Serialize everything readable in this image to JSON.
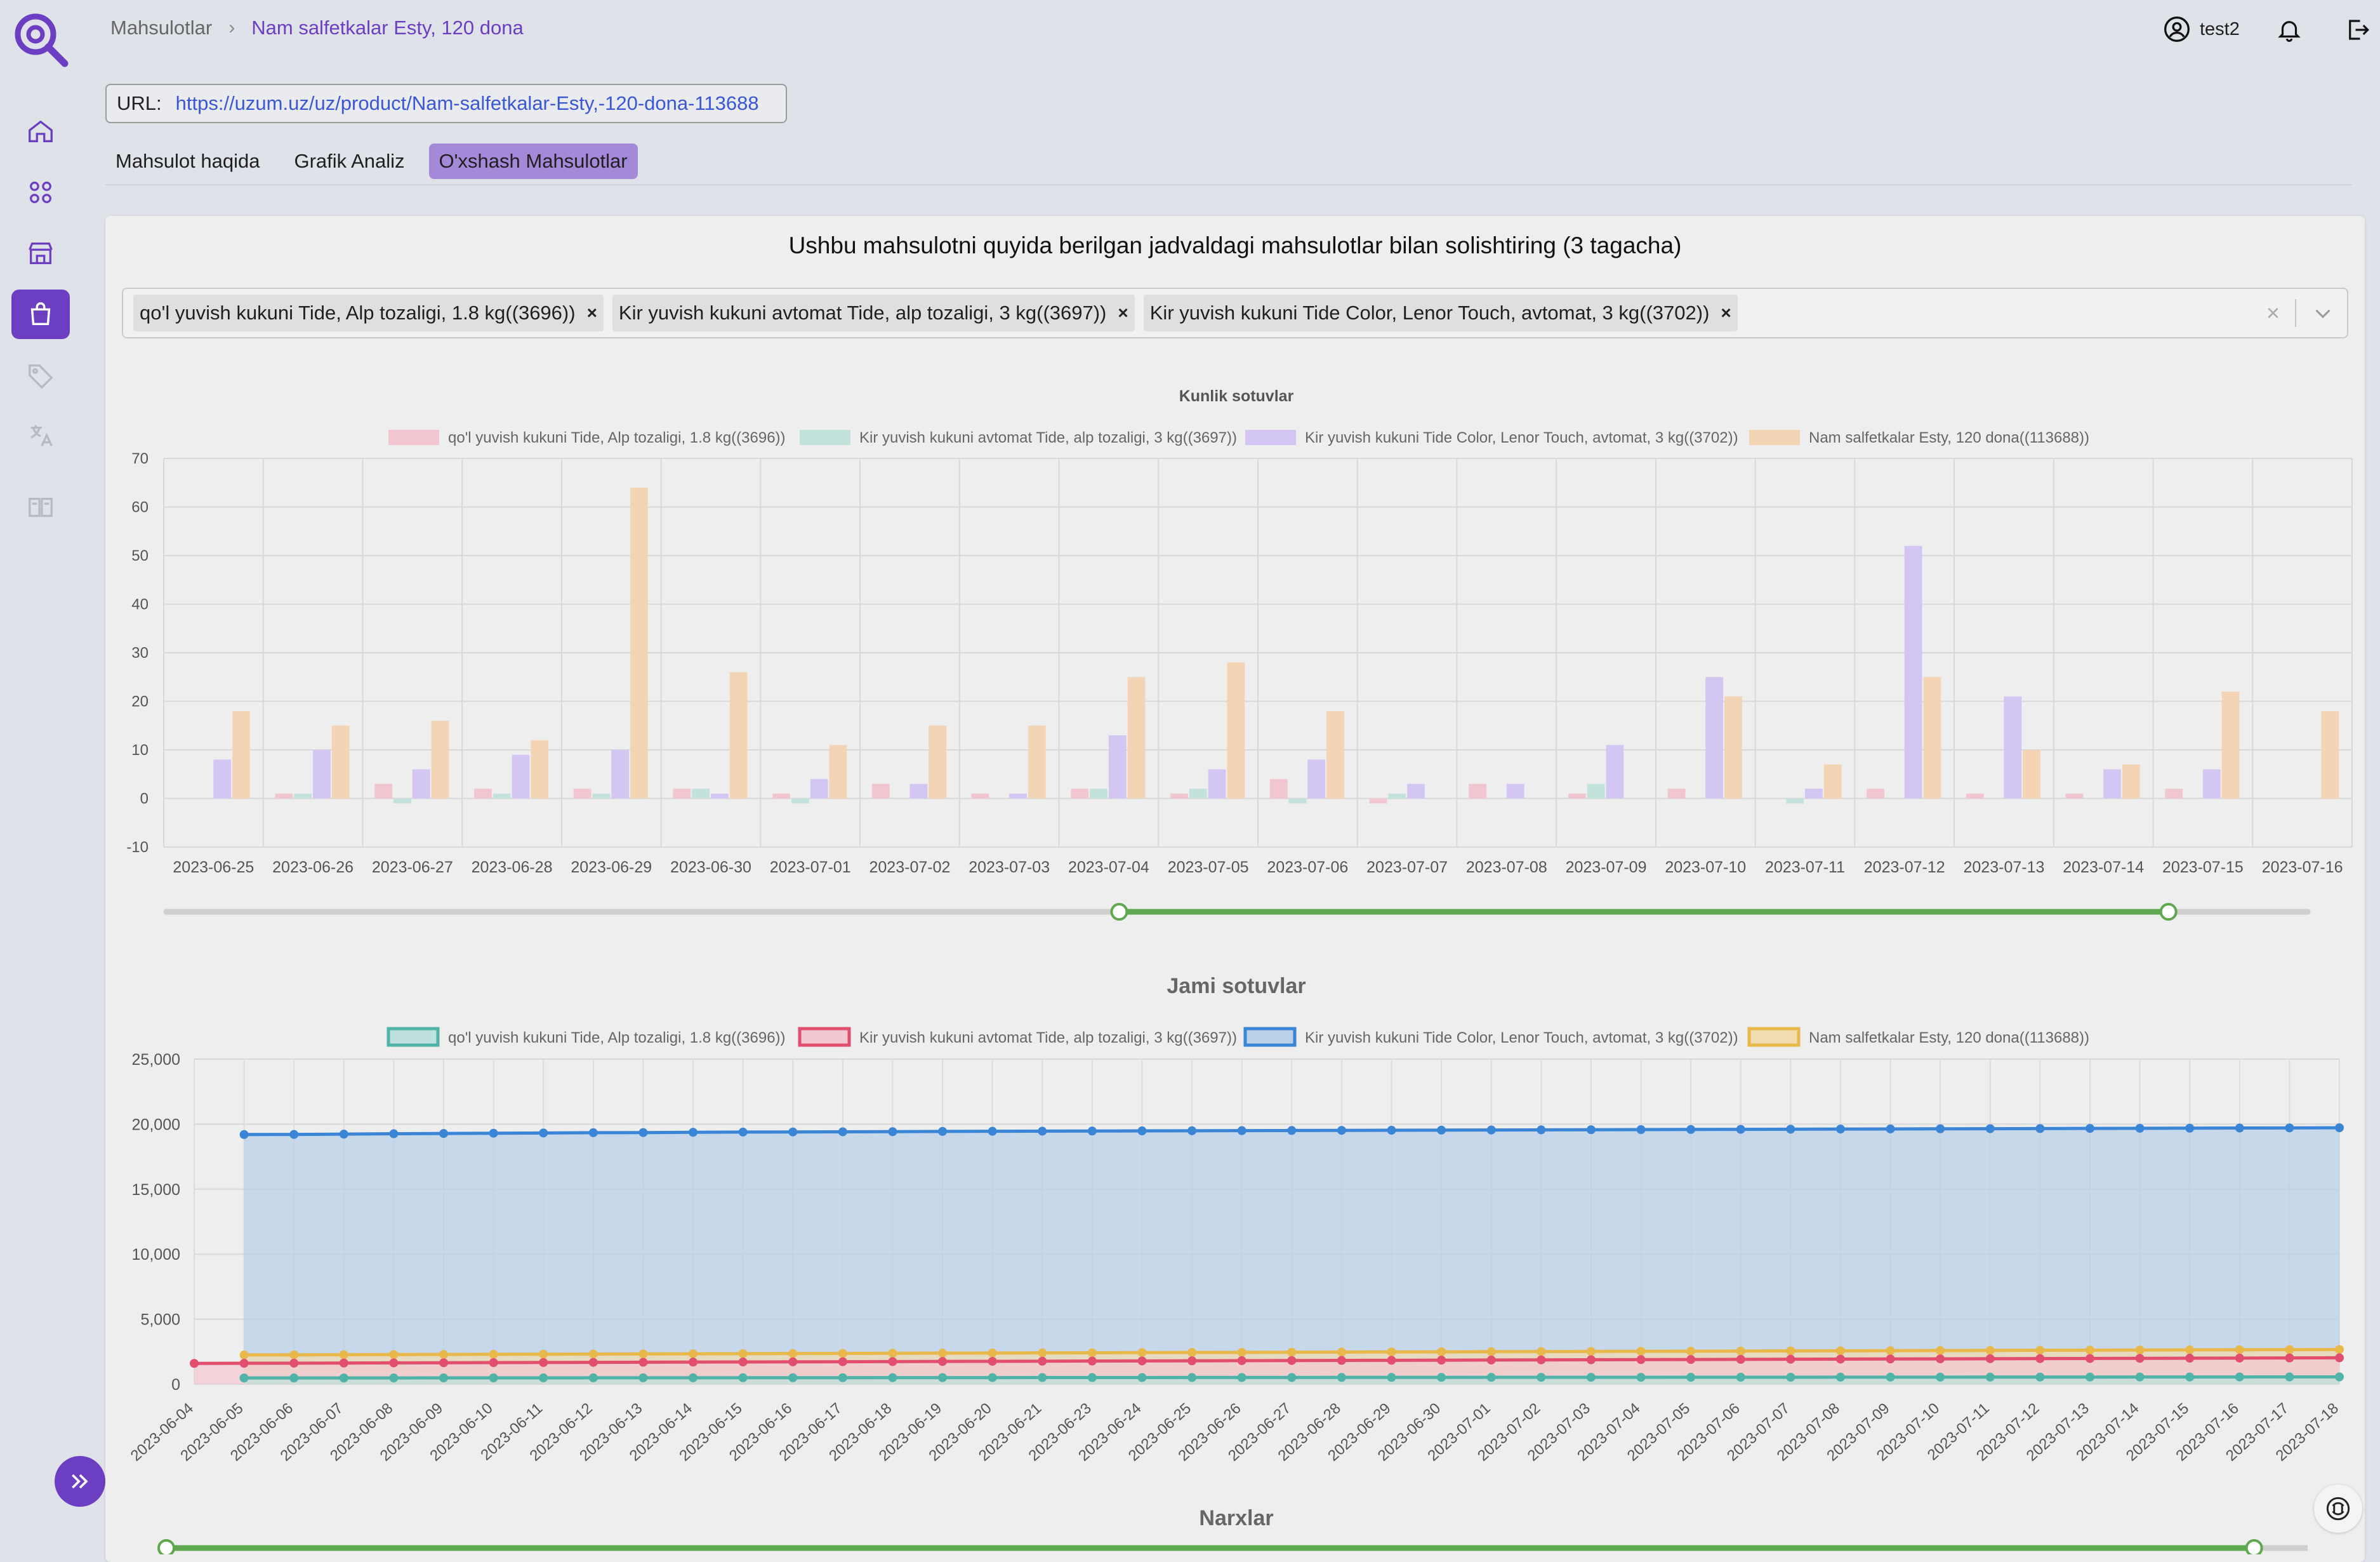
{
  "breadcrumb": {
    "parent": "Mahsulotlar",
    "current": "Nam salfetkalar Esty, 120 dona"
  },
  "user": {
    "name": "test2"
  },
  "url": {
    "label": "URL:",
    "value": "https://uzum.uz/uz/product/Nam-salfetkalar-Esty,-120-dona-113688"
  },
  "tabs": [
    {
      "label": "Mahsulot haqida",
      "active": false
    },
    {
      "label": "Grafik Analiz",
      "active": false
    },
    {
      "label": "O'xshash Mahsulotlar",
      "active": true
    }
  ],
  "compare": {
    "title": "Ushbu mahsulotni quyida berilgan jadvaldagi mahsulotlar bilan solishtiring (3 tagacha)",
    "selected": [
      "qo'l yuvish kukuni Tide, Alp tozaligi, 1.8 kg((3696))",
      "Kir yuvish kukuni avtomat Tide, alp tozaligi, 3 kg((3697))",
      "Kir yuvish kukuni Tide Color, Lenor Touch, avtomat, 3 kg((3702))"
    ],
    "clear_icon": "close-icon",
    "dropdown_icon": "chevron-down-icon"
  },
  "sidebar": {
    "icons": [
      "home-icon",
      "grid-icon",
      "store-icon",
      "shopping-bag-icon",
      "tag-icon",
      "translate-icon",
      "compare-icon"
    ],
    "active_index": 3,
    "expand_icon": "double-chevron-right-icon"
  },
  "chart_data": [
    {
      "type": "bar",
      "title": "Kunlik sotuvlar",
      "categories": [
        "2023-06-25",
        "2023-06-26",
        "2023-06-27",
        "2023-06-28",
        "2023-06-29",
        "2023-06-30",
        "2023-07-01",
        "2023-07-02",
        "2023-07-03",
        "2023-07-04",
        "2023-07-05",
        "2023-07-06",
        "2023-07-07",
        "2023-07-08",
        "2023-07-09",
        "2023-07-10",
        "2023-07-11",
        "2023-07-12",
        "2023-07-13",
        "2023-07-14",
        "2023-07-15",
        "2023-07-16"
      ],
      "ylim": [
        -10,
        70
      ],
      "yticks": [
        -10,
        0,
        10,
        20,
        30,
        40,
        50,
        60,
        70
      ],
      "legend_position": "top",
      "grid": true,
      "series": [
        {
          "name": "qo'l yuvish kukuni Tide, Alp tozaligi, 1.8 kg((3696))",
          "color": "#f2c6d0",
          "values": [
            0,
            1,
            3,
            2,
            2,
            2,
            1,
            3,
            1,
            2,
            1,
            4,
            -1,
            3,
            1,
            2,
            0,
            2,
            1,
            1,
            2,
            0
          ]
        },
        {
          "name": "Kir yuvish kukuni avtomat Tide, alp tozaligi, 3 kg((3697))",
          "color": "#c3e2dc",
          "values": [
            0,
            1,
            -1,
            1,
            1,
            2,
            -1,
            0,
            0,
            2,
            2,
            -1,
            1,
            0,
            3,
            0,
            -1,
            0,
            0,
            0,
            0,
            0
          ]
        },
        {
          "name": "Kir yuvish kukuni Tide Color, Lenor Touch, avtomat, 3 kg((3702))",
          "color": "#d3c6f2",
          "values": [
            8,
            10,
            6,
            9,
            10,
            1,
            4,
            3,
            1,
            13,
            6,
            8,
            3,
            3,
            11,
            25,
            2,
            52,
            21,
            6,
            6,
            0
          ]
        },
        {
          "name": "Nam salfetkalar Esty, 120 dona((113688))",
          "color": "#f3d5b5",
          "values": [
            18,
            15,
            16,
            12,
            64,
            26,
            11,
            15,
            15,
            25,
            28,
            18,
            0,
            0,
            0,
            21,
            7,
            25,
            10,
            7,
            22,
            18
          ]
        }
      ],
      "range_slider": {
        "start_fraction": 0.445,
        "end_fraction": 0.935
      }
    },
    {
      "type": "area",
      "title": "Jami sotuvlar",
      "categories": [
        "2023-06-04",
        "2023-06-05",
        "2023-06-06",
        "2023-06-07",
        "2023-06-08",
        "2023-06-09",
        "2023-06-10",
        "2023-06-11",
        "2023-06-12",
        "2023-06-13",
        "2023-06-14",
        "2023-06-15",
        "2023-06-16",
        "2023-06-17",
        "2023-06-18",
        "2023-06-19",
        "2023-06-20",
        "2023-06-21",
        "2023-06-23",
        "2023-06-24",
        "2023-06-25",
        "2023-06-26",
        "2023-06-27",
        "2023-06-28",
        "2023-06-29",
        "2023-06-30",
        "2023-07-01",
        "2023-07-02",
        "2023-07-03",
        "2023-07-04",
        "2023-07-05",
        "2023-07-06",
        "2023-07-07",
        "2023-07-08",
        "2023-07-09",
        "2023-07-10",
        "2023-07-11",
        "2023-07-12",
        "2023-07-13",
        "2023-07-14",
        "2023-07-15",
        "2023-07-16",
        "2023-07-17",
        "2023-07-18"
      ],
      "ylim": [
        0,
        25000
      ],
      "yticks": [
        "0",
        "5,000",
        "10,000",
        "15,000",
        "20,000",
        "25,000"
      ],
      "legend_position": "top",
      "grid": true,
      "series": [
        {
          "name": "qo'l yuvish kukuni Tide, Alp tozaligi, 1.8 kg((3696))",
          "color": "#4fb3a8",
          "fill": "#bfe0dc",
          "values": [
            null,
            480,
            480,
            482,
            484,
            486,
            488,
            490,
            492,
            494,
            496,
            498,
            500,
            502,
            504,
            506,
            508,
            510,
            512,
            514,
            516,
            518,
            520,
            522,
            524,
            526,
            528,
            530,
            532,
            534,
            536,
            538,
            540,
            542,
            544,
            546,
            548,
            550,
            552,
            554,
            556,
            558,
            560,
            562
          ]
        },
        {
          "name": "Kir yuvish kukuni avtomat Tide, alp tozaligi, 3 kg((3697))",
          "color": "#e24e6e",
          "fill": "#f2c9d2",
          "values": [
            1600,
            1610,
            1620,
            1630,
            1640,
            1650,
            1660,
            1670,
            1680,
            1690,
            1700,
            1710,
            1720,
            1730,
            1740,
            1750,
            1760,
            1770,
            1780,
            1790,
            1800,
            1810,
            1820,
            1830,
            1840,
            1850,
            1860,
            1870,
            1880,
            1890,
            1900,
            1910,
            1920,
            1930,
            1940,
            1950,
            1960,
            1970,
            1980,
            1990,
            2000,
            2010,
            2020,
            2030
          ]
        },
        {
          "name": "Kir yuvish kukuni Tide Color, Lenor Touch, avtomat, 3 kg((3702))",
          "color": "#3a85d6",
          "fill": "#b9d0e8",
          "values": [
            null,
            19200,
            19210,
            19230,
            19260,
            19280,
            19300,
            19320,
            19340,
            19350,
            19370,
            19390,
            19400,
            19410,
            19420,
            19440,
            19450,
            19460,
            19470,
            19480,
            19490,
            19500,
            19510,
            19520,
            19530,
            19540,
            19550,
            19560,
            19570,
            19580,
            19590,
            19600,
            19610,
            19620,
            19630,
            19640,
            19650,
            19660,
            19670,
            19680,
            19690,
            19700,
            19710,
            19720
          ]
        },
        {
          "name": "Nam salfetkalar Esty, 120 dona((113688))",
          "color": "#e8b84a",
          "fill": "#f0dcb0",
          "values": [
            null,
            2250,
            2260,
            2270,
            2280,
            2290,
            2300,
            2310,
            2320,
            2330,
            2340,
            2350,
            2360,
            2370,
            2380,
            2390,
            2400,
            2410,
            2420,
            2430,
            2440,
            2450,
            2460,
            2470,
            2480,
            2490,
            2500,
            2510,
            2520,
            2530,
            2540,
            2550,
            2560,
            2570,
            2580,
            2590,
            2600,
            2610,
            2620,
            2630,
            2640,
            2650,
            2660,
            2670
          ]
        }
      ]
    },
    {
      "type": "line",
      "title": "Narxlar",
      "range_slider": {
        "start_fraction": 0.0,
        "end_fraction": 0.975
      }
    }
  ]
}
